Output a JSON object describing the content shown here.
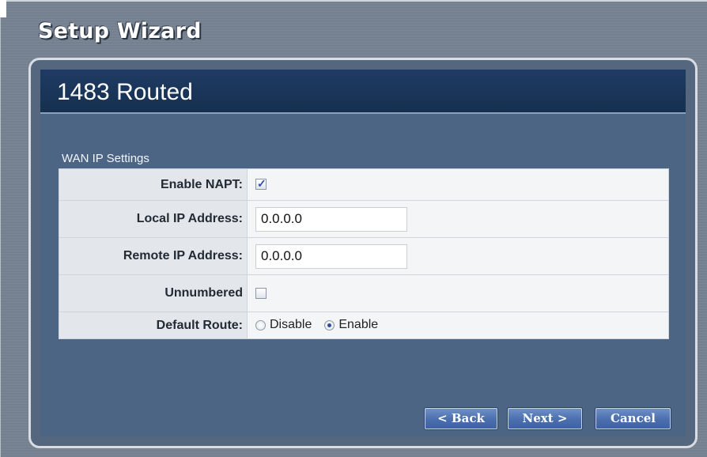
{
  "wizard": {
    "title": "Setup Wizard"
  },
  "panel": {
    "title": "1483 Routed"
  },
  "section": {
    "title": "WAN IP Settings"
  },
  "fields": {
    "enable_napt": {
      "label": "Enable NAPT:",
      "checked": true
    },
    "local_ip": {
      "label": "Local IP Address:",
      "value": "0.0.0.0"
    },
    "remote_ip": {
      "label": "Remote IP Address:",
      "value": "0.0.0.0"
    },
    "unnumbered": {
      "label": "Unnumbered",
      "checked": false
    },
    "default_route": {
      "label": "Default Route:",
      "options": [
        "Disable",
        "Enable"
      ],
      "selected": "Enable"
    }
  },
  "buttons": {
    "back": "< Back",
    "next": "Next >",
    "cancel": "Cancel"
  },
  "colors": {
    "header_bg": "#1f3b63",
    "panel_bg": "#4d6585",
    "button_bg": "#4a6fae"
  }
}
